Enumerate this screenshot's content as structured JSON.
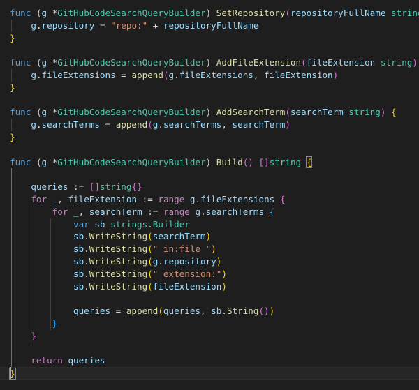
{
  "editor": {
    "language": "go",
    "line_height": 17.8,
    "lines": [
      [
        [
          "kw",
          "func"
        ],
        [
          "op",
          " ("
        ],
        [
          "var",
          "g"
        ],
        [
          "op",
          " *"
        ],
        [
          "type",
          "GitHubCodeSearchQueryBuilder"
        ],
        [
          "op",
          ") "
        ],
        [
          "fn",
          "SetRepository"
        ],
        [
          "b2",
          "("
        ],
        [
          "var",
          "repositoryFullName"
        ],
        [
          "op",
          " "
        ],
        [
          "type",
          "string"
        ],
        [
          "b2",
          ")"
        ],
        [
          "op",
          " "
        ],
        [
          "b1",
          "{"
        ]
      ],
      [
        [
          "op",
          "    "
        ],
        [
          "var",
          "g"
        ],
        [
          "op",
          "."
        ],
        [
          "var",
          "repository"
        ],
        [
          "op",
          " = "
        ],
        [
          "str",
          "\"repo:\""
        ],
        [
          "op",
          " + "
        ],
        [
          "var",
          "repositoryFullName"
        ]
      ],
      [
        [
          "b1",
          "}"
        ]
      ],
      [],
      [
        [
          "kw",
          "func"
        ],
        [
          "op",
          " ("
        ],
        [
          "var",
          "g"
        ],
        [
          "op",
          " *"
        ],
        [
          "type",
          "GitHubCodeSearchQueryBuilder"
        ],
        [
          "op",
          ") "
        ],
        [
          "fn",
          "AddFileExtension"
        ],
        [
          "b2",
          "("
        ],
        [
          "var",
          "fileExtension"
        ],
        [
          "op",
          " "
        ],
        [
          "type",
          "string"
        ],
        [
          "b2",
          ")"
        ],
        [
          "op",
          " "
        ],
        [
          "b1",
          "{"
        ]
      ],
      [
        [
          "op",
          "    "
        ],
        [
          "var",
          "g"
        ],
        [
          "op",
          "."
        ],
        [
          "var",
          "fileExtensions"
        ],
        [
          "op",
          " = "
        ],
        [
          "fn",
          "append"
        ],
        [
          "b2",
          "("
        ],
        [
          "var",
          "g"
        ],
        [
          "op",
          "."
        ],
        [
          "var",
          "fileExtensions"
        ],
        [
          "op",
          ", "
        ],
        [
          "var",
          "fileExtension"
        ],
        [
          "b2",
          ")"
        ]
      ],
      [
        [
          "b1",
          "}"
        ]
      ],
      [],
      [
        [
          "kw",
          "func"
        ],
        [
          "op",
          " ("
        ],
        [
          "var",
          "g"
        ],
        [
          "op",
          " *"
        ],
        [
          "type",
          "GitHubCodeSearchQueryBuilder"
        ],
        [
          "op",
          ") "
        ],
        [
          "fn",
          "AddSearchTerm"
        ],
        [
          "b2",
          "("
        ],
        [
          "var",
          "searchTerm"
        ],
        [
          "op",
          " "
        ],
        [
          "type",
          "string"
        ],
        [
          "b2",
          ")"
        ],
        [
          "op",
          " "
        ],
        [
          "b1",
          "{"
        ]
      ],
      [
        [
          "op",
          "    "
        ],
        [
          "var",
          "g"
        ],
        [
          "op",
          "."
        ],
        [
          "var",
          "searchTerms"
        ],
        [
          "op",
          " = "
        ],
        [
          "fn",
          "append"
        ],
        [
          "b2",
          "("
        ],
        [
          "var",
          "g"
        ],
        [
          "op",
          "."
        ],
        [
          "var",
          "searchTerms"
        ],
        [
          "op",
          ", "
        ],
        [
          "var",
          "searchTerm"
        ],
        [
          "b2",
          ")"
        ]
      ],
      [
        [
          "b1",
          "}"
        ]
      ],
      [],
      [
        [
          "kw",
          "func"
        ],
        [
          "op",
          " ("
        ],
        [
          "var",
          "g"
        ],
        [
          "op",
          " *"
        ],
        [
          "type",
          "GitHubCodeSearchQueryBuilder"
        ],
        [
          "op",
          ") "
        ],
        [
          "fn",
          "Build"
        ],
        [
          "b2",
          "()"
        ],
        [
          "op",
          " "
        ],
        [
          "b2",
          "[]"
        ],
        [
          "type",
          "string"
        ],
        [
          "op",
          " "
        ],
        [
          "b1",
          "{"
        ]
      ],
      [],
      [
        [
          "op",
          "    "
        ],
        [
          "var",
          "queries"
        ],
        [
          "op",
          " := "
        ],
        [
          "b2",
          "[]"
        ],
        [
          "type",
          "string"
        ],
        [
          "b2",
          "{}"
        ]
      ],
      [
        [
          "op",
          "    "
        ],
        [
          "ctl",
          "for"
        ],
        [
          "op",
          " "
        ],
        [
          "var",
          "_"
        ],
        [
          "op",
          ", "
        ],
        [
          "var",
          "fileExtension"
        ],
        [
          "op",
          " := "
        ],
        [
          "ctl",
          "range"
        ],
        [
          "op",
          " "
        ],
        [
          "var",
          "g"
        ],
        [
          "op",
          "."
        ],
        [
          "var",
          "fileExtensions"
        ],
        [
          "op",
          " "
        ],
        [
          "b2",
          "{"
        ]
      ],
      [
        [
          "op",
          "        "
        ],
        [
          "ctl",
          "for"
        ],
        [
          "op",
          " "
        ],
        [
          "var",
          "_"
        ],
        [
          "op",
          ", "
        ],
        [
          "var",
          "searchTerm"
        ],
        [
          "op",
          " := "
        ],
        [
          "ctl",
          "range"
        ],
        [
          "op",
          " "
        ],
        [
          "var",
          "g"
        ],
        [
          "op",
          "."
        ],
        [
          "var",
          "searchTerms"
        ],
        [
          "op",
          " "
        ],
        [
          "b3",
          "{"
        ]
      ],
      [
        [
          "op",
          "            "
        ],
        [
          "kw",
          "var"
        ],
        [
          "op",
          " "
        ],
        [
          "var",
          "sb"
        ],
        [
          "op",
          " "
        ],
        [
          "type",
          "strings"
        ],
        [
          "op",
          "."
        ],
        [
          "type",
          "Builder"
        ]
      ],
      [
        [
          "op",
          "            "
        ],
        [
          "var",
          "sb"
        ],
        [
          "op",
          "."
        ],
        [
          "fn",
          "WriteString"
        ],
        [
          "b1",
          "("
        ],
        [
          "var",
          "searchTerm"
        ],
        [
          "b1",
          ")"
        ]
      ],
      [
        [
          "op",
          "            "
        ],
        [
          "var",
          "sb"
        ],
        [
          "op",
          "."
        ],
        [
          "fn",
          "WriteString"
        ],
        [
          "b1",
          "("
        ],
        [
          "str",
          "\" in:file \""
        ],
        [
          "b1",
          ")"
        ]
      ],
      [
        [
          "op",
          "            "
        ],
        [
          "var",
          "sb"
        ],
        [
          "op",
          "."
        ],
        [
          "fn",
          "WriteString"
        ],
        [
          "b1",
          "("
        ],
        [
          "var",
          "g"
        ],
        [
          "op",
          "."
        ],
        [
          "var",
          "repository"
        ],
        [
          "b1",
          ")"
        ]
      ],
      [
        [
          "op",
          "            "
        ],
        [
          "var",
          "sb"
        ],
        [
          "op",
          "."
        ],
        [
          "fn",
          "WriteString"
        ],
        [
          "b1",
          "("
        ],
        [
          "str",
          "\" extension:\""
        ],
        [
          "b1",
          ")"
        ]
      ],
      [
        [
          "op",
          "            "
        ],
        [
          "var",
          "sb"
        ],
        [
          "op",
          "."
        ],
        [
          "fn",
          "WriteString"
        ],
        [
          "b1",
          "("
        ],
        [
          "var",
          "fileExtension"
        ],
        [
          "b1",
          ")"
        ]
      ],
      [],
      [
        [
          "op",
          "            "
        ],
        [
          "var",
          "queries"
        ],
        [
          "op",
          " = "
        ],
        [
          "fn",
          "append"
        ],
        [
          "b1",
          "("
        ],
        [
          "var",
          "queries"
        ],
        [
          "op",
          ", "
        ],
        [
          "var",
          "sb"
        ],
        [
          "op",
          "."
        ],
        [
          "fn",
          "String"
        ],
        [
          "b2",
          "()"
        ],
        [
          "b1",
          ")"
        ]
      ],
      [
        [
          "op",
          "        "
        ],
        [
          "b3",
          "}"
        ]
      ],
      [
        [
          "op",
          "    "
        ],
        [
          "b2",
          "}"
        ]
      ],
      [],
      [
        [
          "op",
          "    "
        ],
        [
          "ctl",
          "return"
        ],
        [
          "op",
          " "
        ],
        [
          "var",
          "queries"
        ]
      ],
      [
        [
          "b1",
          "}"
        ]
      ]
    ]
  }
}
